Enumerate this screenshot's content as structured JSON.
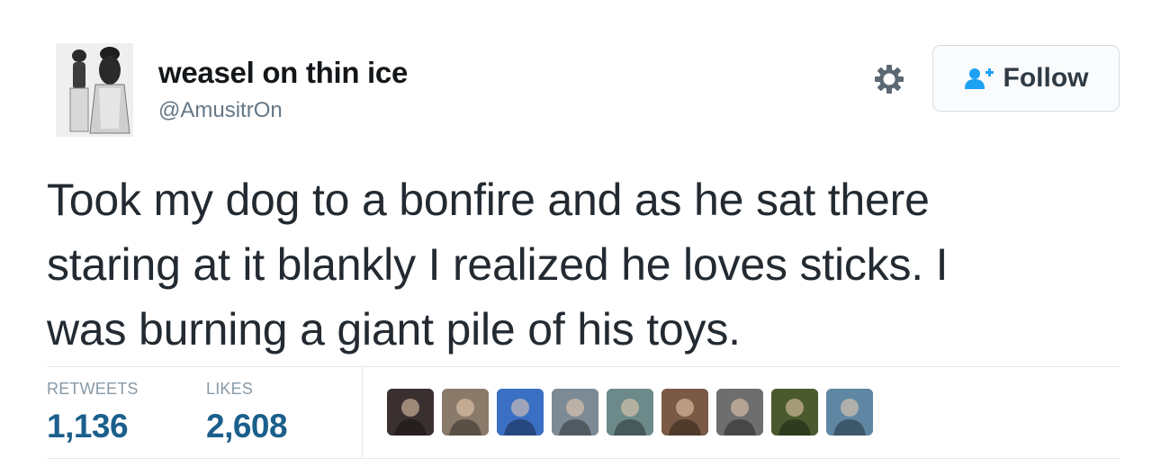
{
  "user": {
    "display_name": "weasel on thin ice",
    "handle": "@AmusitrOn",
    "avatar_icon": "vintage-photo-avatar"
  },
  "actions": {
    "settings_icon": "gear-icon",
    "follow_label": "Follow",
    "follow_icon": "add-user-icon",
    "follow_color": "#1da1f2"
  },
  "tweet": {
    "lines": [
      "Took my dog to a bonfire and as he sat there",
      "staring at it blankly I realized he loves sticks. I",
      "was burning a giant pile of his toys."
    ]
  },
  "stats": {
    "retweets_label": "RETWEETS",
    "retweets_value": "1,136",
    "likes_label": "LIKES",
    "likes_value": "2,608",
    "value_color": "#1b5f8c"
  },
  "likers": [
    {
      "name": "liker-avatar-1",
      "color": "#3a3030"
    },
    {
      "name": "liker-avatar-2",
      "color": "#8a7a6a"
    },
    {
      "name": "liker-avatar-3",
      "color": "#3b6fc4"
    },
    {
      "name": "liker-avatar-4",
      "color": "#7c8a95"
    },
    {
      "name": "liker-avatar-5",
      "color": "#6d8a8a"
    },
    {
      "name": "liker-avatar-6",
      "color": "#7a5a44"
    },
    {
      "name": "liker-avatar-7",
      "color": "#6e6e6e"
    },
    {
      "name": "liker-avatar-8",
      "color": "#4a5a2e"
    },
    {
      "name": "liker-avatar-9",
      "color": "#5f87a3"
    }
  ]
}
